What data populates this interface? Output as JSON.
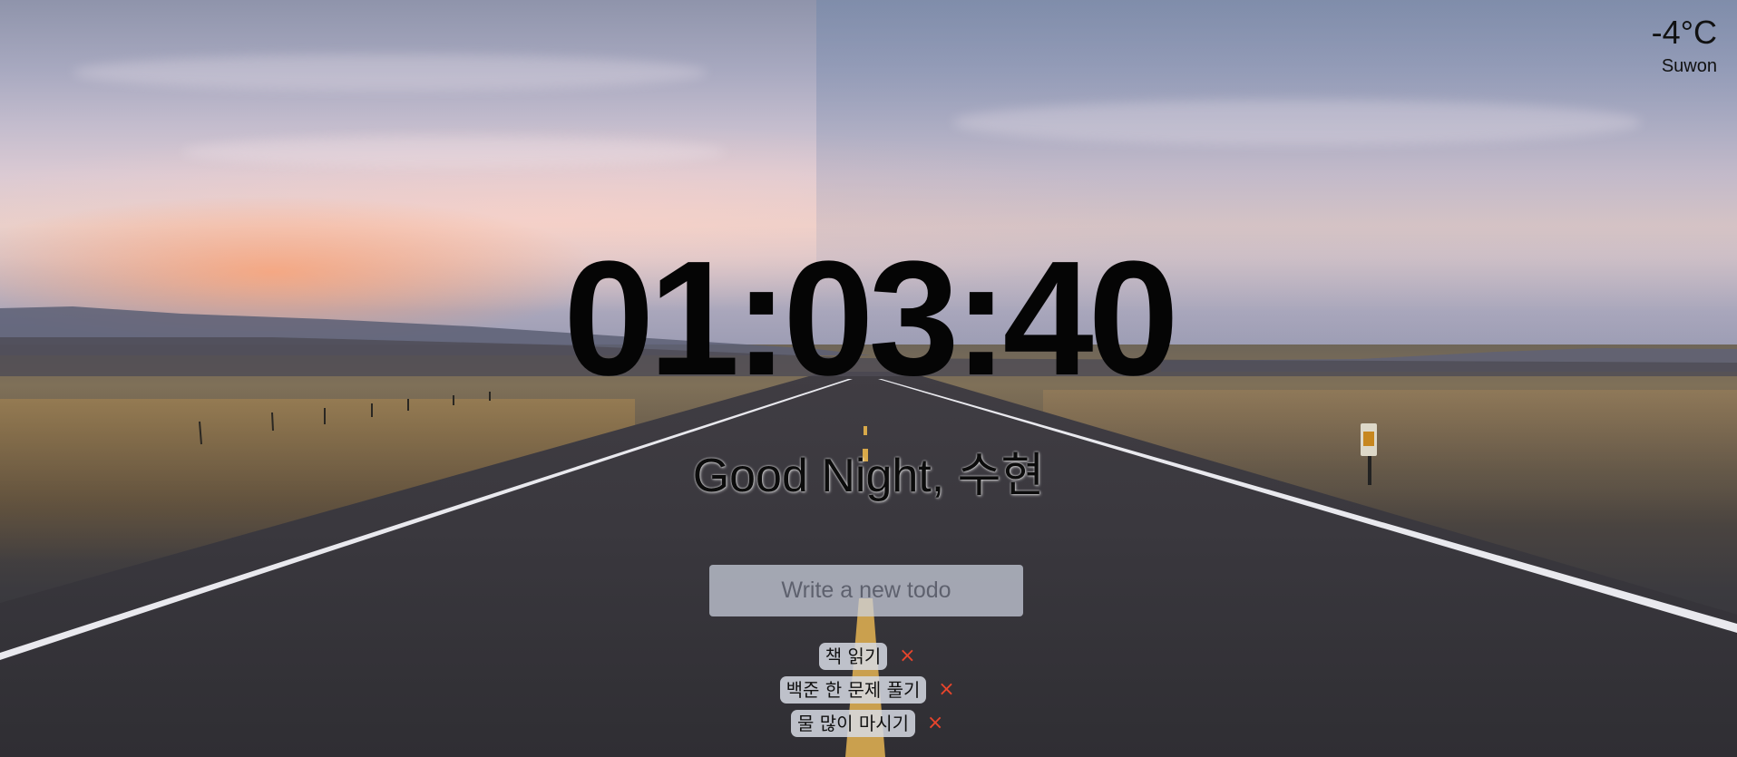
{
  "weather": {
    "temperature": "-4°C",
    "city": "Suwon"
  },
  "clock": {
    "time": "01:03:40"
  },
  "greeting": {
    "text": "Good Night, 수현"
  },
  "todo_form": {
    "placeholder": "Write a new todo",
    "value": ""
  },
  "todos": [
    {
      "text": "책 읽기",
      "delete_icon": "×"
    },
    {
      "text": "백준 한 문제 풀기",
      "delete_icon": "×"
    },
    {
      "text": "물 많이 마시기",
      "delete_icon": "×"
    }
  ],
  "colors": {
    "delete_icon": "#e8452c",
    "clock_text": "#050505",
    "input_background": "rgba(205,210,225,0.72)"
  }
}
